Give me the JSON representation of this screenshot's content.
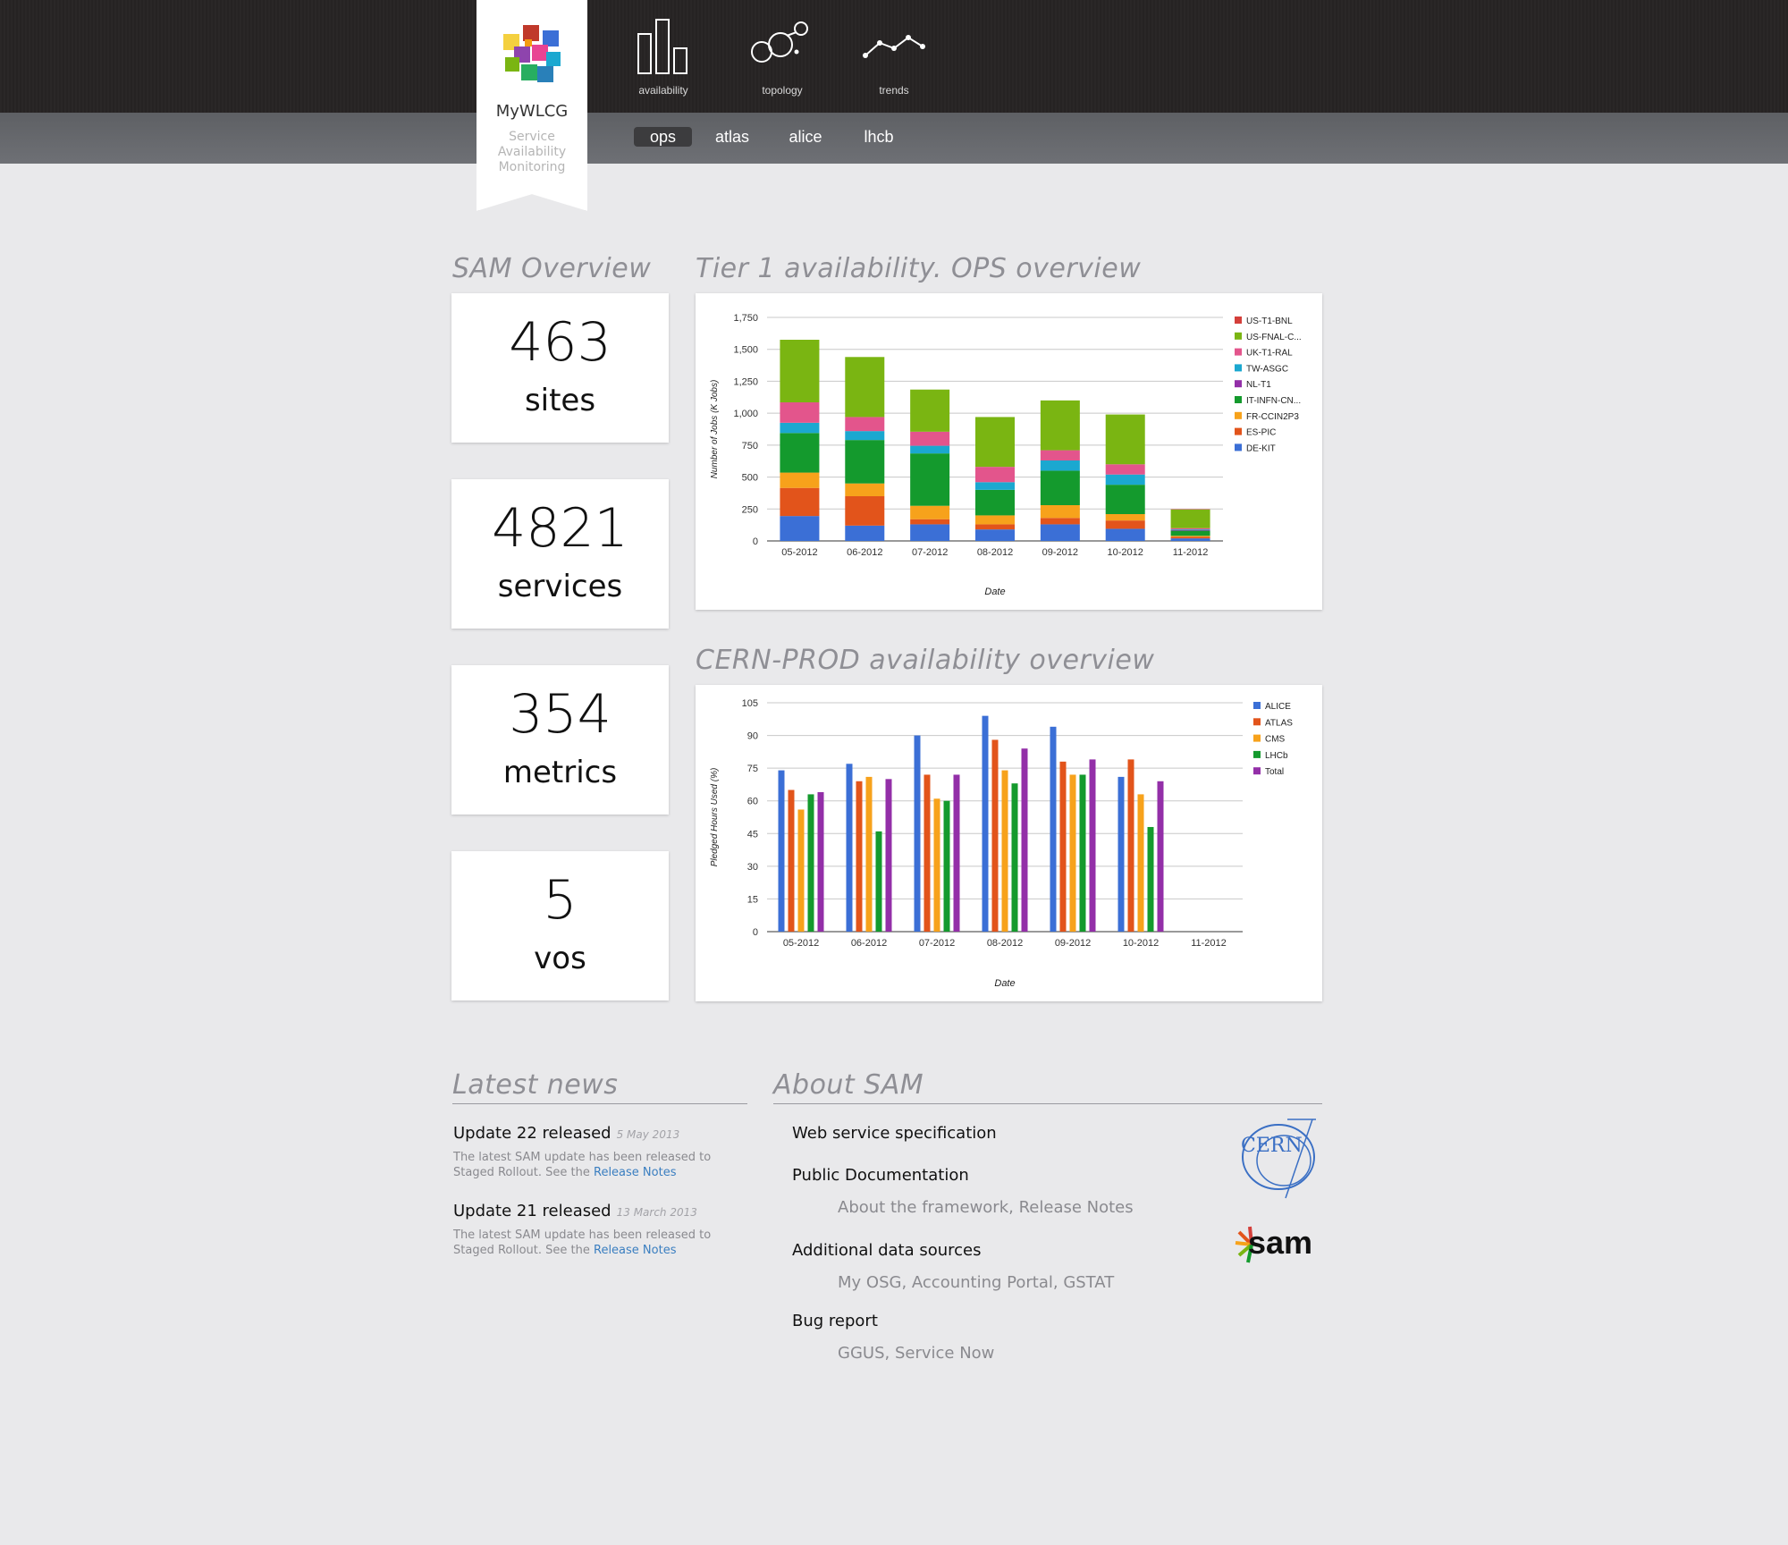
{
  "brand": {
    "name": "MyWLCG",
    "subtitle_lines": [
      "Service",
      "Availability",
      "Monitoring"
    ]
  },
  "nav": [
    {
      "label": "availability",
      "icon": "bar-chart-icon"
    },
    {
      "label": "topology",
      "icon": "topology-icon"
    },
    {
      "label": "trends",
      "icon": "trend-line-icon"
    }
  ],
  "vo_tabs": [
    {
      "label": "ops",
      "active": true
    },
    {
      "label": "atlas",
      "active": false
    },
    {
      "label": "alice",
      "active": false
    },
    {
      "label": "lhcb",
      "active": false
    }
  ],
  "overview": {
    "title": "SAM Overview",
    "stats": [
      {
        "value": "463",
        "label": "sites"
      },
      {
        "value": "4821",
        "label": "services"
      },
      {
        "value": "354",
        "label": "metrics"
      },
      {
        "value": "5",
        "label": "vos"
      }
    ]
  },
  "charts": {
    "tier1_title": "Tier 1 availability. OPS overview",
    "cern_title": "CERN-PROD availability overview"
  },
  "chart_data": [
    {
      "type": "bar",
      "stacked": true,
      "xlabel": "Date",
      "ylabel": "Number of Jobs (K Jobs)",
      "ylim": [
        0,
        1750
      ],
      "yticks": [
        "0",
        "250",
        "500",
        "750",
        "1,000",
        "1,250",
        "1,500",
        "1,750"
      ],
      "categories": [
        "05-2012",
        "06-2012",
        "07-2012",
        "08-2012",
        "09-2012",
        "10-2012",
        "11-2012"
      ],
      "legend_position": "right",
      "series": [
        {
          "name": "DE-KIT",
          "color": "#3b6fd6",
          "values": [
            195,
            120,
            130,
            90,
            130,
            95,
            20
          ]
        },
        {
          "name": "ES-PIC",
          "color": "#e2541b",
          "values": [
            220,
            230,
            40,
            40,
            50,
            65,
            12
          ]
        },
        {
          "name": "FR-CCIN2P3",
          "color": "#f7a21b",
          "values": [
            120,
            100,
            105,
            70,
            100,
            50,
            8
          ]
        },
        {
          "name": "IT-INFN-CN...",
          "color": "#149a2d",
          "values": [
            310,
            340,
            410,
            200,
            270,
            230,
            40
          ]
        },
        {
          "name": "NL-T1",
          "color": "#932fa8",
          "values": [
            0,
            0,
            0,
            0,
            0,
            0,
            4
          ]
        },
        {
          "name": "TW-ASGC",
          "color": "#1ba8d0",
          "values": [
            80,
            70,
            60,
            60,
            80,
            80,
            6
          ]
        },
        {
          "name": "UK-T1-RAL",
          "color": "#e3558c",
          "values": [
            160,
            110,
            110,
            120,
            80,
            80,
            10
          ]
        },
        {
          "name": "US-FNAL-C...",
          "color": "#7ab512",
          "values": [
            490,
            470,
            330,
            390,
            390,
            390,
            145
          ]
        },
        {
          "name": "US-T1-BNL",
          "color": "#d43f3a",
          "values": [
            0,
            0,
            0,
            0,
            0,
            0,
            3
          ]
        }
      ]
    },
    {
      "type": "bar",
      "xlabel": "Date",
      "ylabel": "Pledged Hours Used (%)",
      "ylim": [
        0,
        105
      ],
      "yticks": [
        "0",
        "15",
        "30",
        "45",
        "60",
        "75",
        "90",
        "105"
      ],
      "categories": [
        "05-2012",
        "06-2012",
        "07-2012",
        "08-2012",
        "09-2012",
        "10-2012",
        "11-2012"
      ],
      "legend_position": "right",
      "series": [
        {
          "name": "ALICE",
          "color": "#3b6fd6",
          "values": [
            74,
            77,
            90,
            99,
            94,
            71,
            null
          ]
        },
        {
          "name": "ATLAS",
          "color": "#e2541b",
          "values": [
            65,
            69,
            72,
            88,
            78,
            79,
            null
          ]
        },
        {
          "name": "CMS",
          "color": "#f7a21b",
          "values": [
            56,
            71,
            61,
            74,
            72,
            63,
            null
          ]
        },
        {
          "name": "LHCb",
          "color": "#149a2d",
          "values": [
            63,
            46,
            60,
            68,
            72,
            48,
            null
          ]
        },
        {
          "name": "Total",
          "color": "#932fa8",
          "values": [
            64,
            70,
            72,
            84,
            79,
            69,
            null
          ]
        }
      ]
    }
  ],
  "news": {
    "title": "Latest news",
    "items": [
      {
        "title": "Update 22 released",
        "date": "5 May 2013",
        "body": "The latest SAM update has been released to Staged Rollout. See the",
        "link": "Release Notes"
      },
      {
        "title": "Update 21 released",
        "date": "13 March 2013",
        "body": "The latest SAM update has been released to Staged Rollout. See the",
        "link": "Release Notes"
      }
    ]
  },
  "about": {
    "title": "About SAM",
    "ws_spec": "Web service specification",
    "public_docs": "Public Documentation",
    "public_docs_links": [
      "About the framework",
      "Release Notes"
    ],
    "additional": "Additional data sources",
    "additional_links": [
      "My OSG",
      "Accounting Portal",
      "GSTAT"
    ],
    "bug_report": "Bug report",
    "bug_links": [
      "GGUS",
      "Service Now"
    ],
    "cern_logo_text": "CERN",
    "sam_logo_text": "sam"
  }
}
